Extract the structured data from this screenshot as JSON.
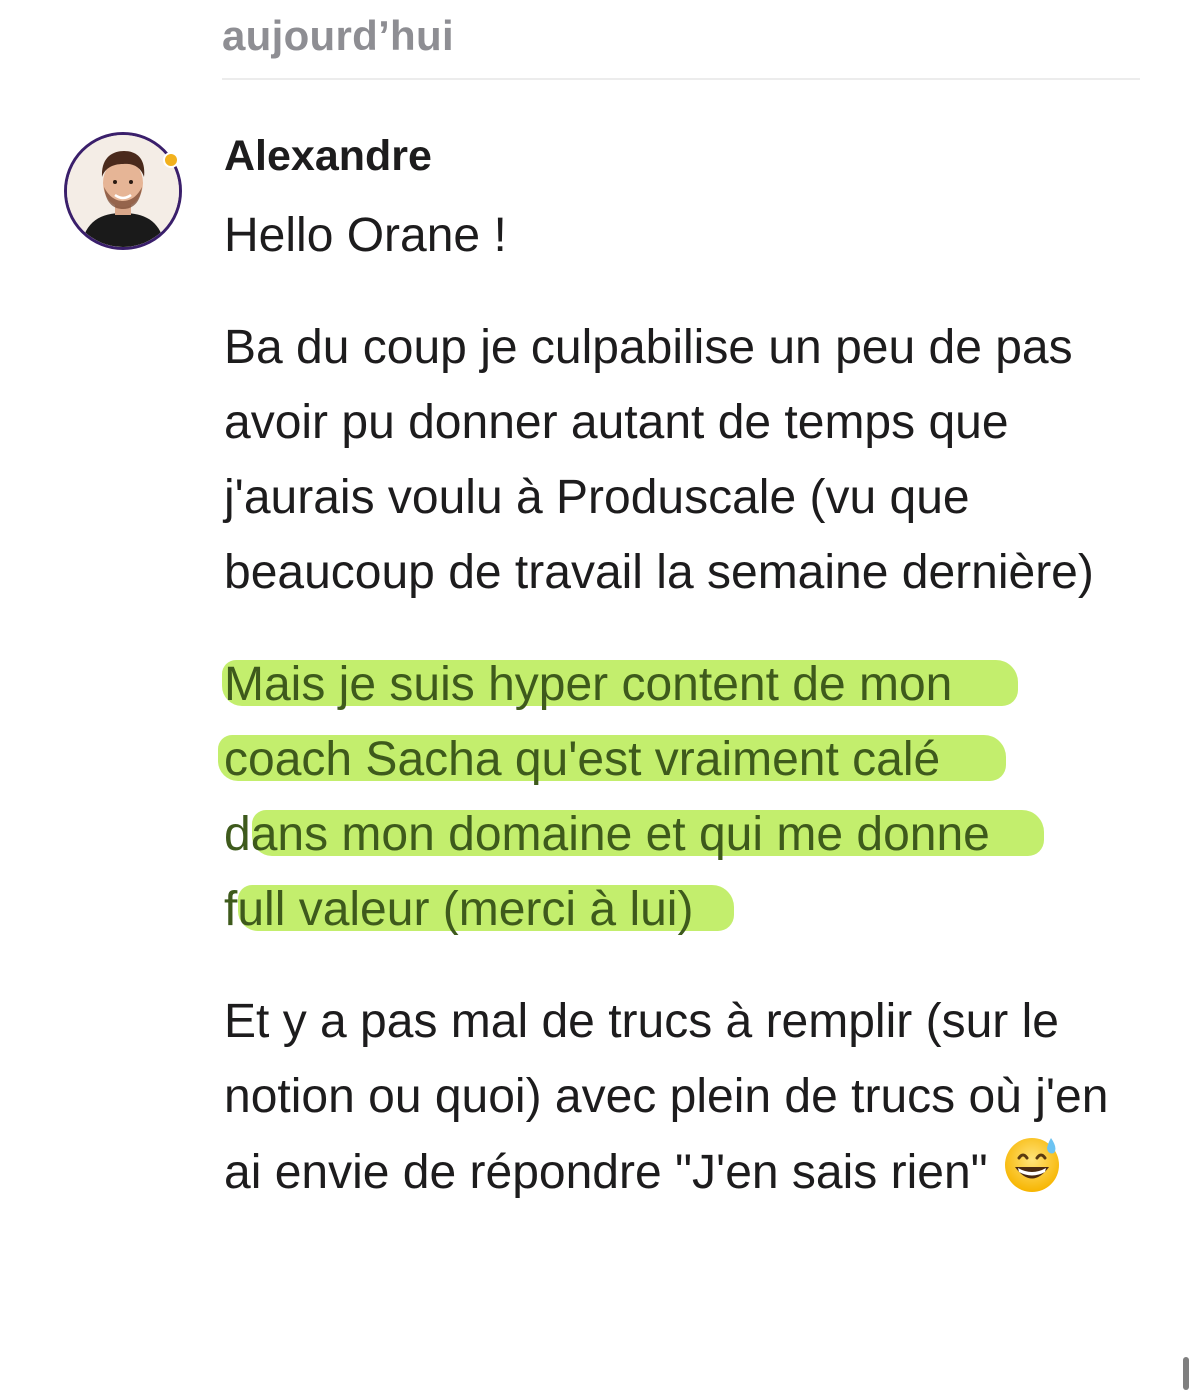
{
  "date_header": "aujourd’hui",
  "message": {
    "author": "Alexandre",
    "paragraphs": [
      "Hello Orane !",
      "Ba du coup je culpabilise un peu de pas avoir pu donner autant de temps que j'aurais voulu à Produscale (vu que beaucoup de travail la semaine dernière)"
    ],
    "highlighted_lines": [
      "Mais je suis hyper content de mon",
      "coach Sacha qu'est vraiment calé",
      "dans mon domaine et qui me donne",
      "full valeur (merci à lui)"
    ],
    "last_paragraph": "Et y a pas mal de trucs à remplir (sur le notion ou quoi) avec plein de trucs où j'en ai envie de répondre \"J'en sais rien\"",
    "emoji": "grinning-face-with-sweat-emoji"
  },
  "colors": {
    "highlight": "#afe83c",
    "avatar_ring": "#3a1f6b",
    "status_dot": "#f2b11d",
    "date_text": "#8e8e93"
  }
}
